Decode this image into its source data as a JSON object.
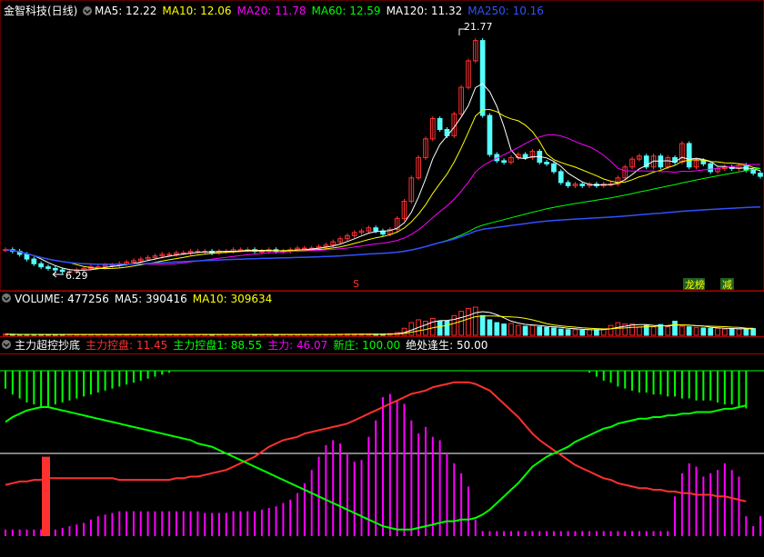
{
  "header": {
    "title": "金智科技(日线)",
    "ma": [
      {
        "label": "MA5: 12.22",
        "color": "#ffffff"
      },
      {
        "label": "MA10: 12.06",
        "color": "#ffff00"
      },
      {
        "label": "MA20: 11.78",
        "color": "#ff00ff"
      },
      {
        "label": "MA60: 12.59",
        "color": "#00ff00"
      },
      {
        "label": "MA120: 11.32",
        "color": "#ffffff"
      },
      {
        "label": "MA250: 10.16",
        "color": "#3050ff"
      }
    ]
  },
  "price_annotations": {
    "high": "21.77",
    "low": "6.29"
  },
  "markers": {
    "s": "S",
    "longhu": "龙榜",
    "reduce": "减"
  },
  "volume_header": [
    {
      "label": "VOLUME: 477256",
      "color": "#ffffff"
    },
    {
      "label": "MA5: 390416",
      "color": "#ffffff"
    },
    {
      "label": "MA10: 309634",
      "color": "#ffff00"
    }
  ],
  "indicator_header": [
    {
      "label": "主力超控抄底",
      "color": "#ffffff"
    },
    {
      "label": "主力控盘: 11.45",
      "color": "#ff3030"
    },
    {
      "label": "主力控盘1: 88.55",
      "color": "#00ff00"
    },
    {
      "label": "主力: 46.07",
      "color": "#ff00ff"
    },
    {
      "label": "新庄: 100.00",
      "color": "#00ff00"
    },
    {
      "label": "绝处逢生: 50.00",
      "color": "#ffffff"
    }
  ],
  "colors": {
    "up": "#ff3030",
    "down": "#54ffff",
    "ma5": "#ffffff",
    "ma10": "#ffff00",
    "ma20": "#ff00ff",
    "ma60": "#00ff00",
    "ma250": "#3050ff",
    "grid": "#b00000"
  },
  "chart_data": {
    "type": "candlestick",
    "price_min": 5.5,
    "price_max": 22.5,
    "close": [
      7.9,
      7.8,
      7.6,
      7.3,
      7.0,
      6.8,
      6.7,
      6.6,
      6.5,
      6.5,
      6.6,
      6.7,
      6.8,
      6.8,
      6.9,
      6.9,
      7.0,
      7.1,
      7.2,
      7.3,
      7.4,
      7.5,
      7.6,
      7.6,
      7.7,
      7.7,
      7.8,
      7.8,
      7.8,
      7.7,
      7.8,
      7.8,
      7.9,
      7.9,
      7.9,
      7.8,
      7.8,
      7.9,
      7.8,
      7.8,
      7.9,
      8.0,
      8.0,
      8.0,
      8.1,
      8.2,
      8.4,
      8.6,
      8.8,
      9.0,
      9.1,
      9.3,
      9.1,
      8.9,
      9.2,
      9.9,
      11.0,
      12.5,
      13.8,
      15.0,
      16.3,
      15.6,
      15.2,
      16.6,
      18.3,
      20.0,
      21.3,
      16.5,
      14.0,
      13.6,
      13.5,
      13.8,
      14.0,
      13.8,
      14.2,
      13.5,
      13.4,
      12.9,
      12.2,
      12.0,
      12.1,
      12.0,
      12.1,
      12.0,
      12.1,
      12.1,
      12.5,
      13.2,
      13.7,
      13.9,
      13.2,
      13.9,
      13.2,
      13.8,
      13.5,
      14.7,
      13.2,
      13.6,
      13.4,
      12.9,
      13.1,
      13.2,
      13.1,
      13.3,
      13.0,
      12.8,
      12.6
    ],
    "volume": [
      0.04,
      0.03,
      0.03,
      0.03,
      0.03,
      0.03,
      0.03,
      0.03,
      0.03,
      0.03,
      0.03,
      0.03,
      0.03,
      0.03,
      0.03,
      0.03,
      0.03,
      0.03,
      0.03,
      0.03,
      0.03,
      0.03,
      0.03,
      0.03,
      0.03,
      0.03,
      0.03,
      0.03,
      0.03,
      0.03,
      0.03,
      0.03,
      0.03,
      0.03,
      0.03,
      0.03,
      0.03,
      0.03,
      0.03,
      0.03,
      0.03,
      0.03,
      0.03,
      0.03,
      0.03,
      0.03,
      0.03,
      0.04,
      0.04,
      0.04,
      0.04,
      0.04,
      0.04,
      0.04,
      0.06,
      0.1,
      0.25,
      0.45,
      0.55,
      0.5,
      0.6,
      0.5,
      0.5,
      0.7,
      0.85,
      0.95,
      1.0,
      0.7,
      0.55,
      0.45,
      0.4,
      0.42,
      0.35,
      0.32,
      0.35,
      0.3,
      0.28,
      0.26,
      0.22,
      0.2,
      0.2,
      0.18,
      0.2,
      0.2,
      0.22,
      0.35,
      0.45,
      0.4,
      0.4,
      0.3,
      0.35,
      0.3,
      0.38,
      0.3,
      0.5,
      0.32,
      0.3,
      0.28,
      0.26,
      0.24,
      0.25,
      0.22,
      0.24,
      0.22,
      0.23,
      0.24
    ],
    "main_control": [
      31,
      32,
      33,
      33,
      34,
      34,
      35,
      35,
      35,
      35,
      35,
      35,
      35,
      35,
      35,
      35,
      34,
      34,
      34,
      34,
      34,
      34,
      34,
      34,
      35,
      35,
      36,
      36,
      37,
      38,
      39,
      40,
      42,
      44,
      46,
      48,
      51,
      54,
      56,
      58,
      59,
      60,
      62,
      63,
      64,
      65,
      66,
      67,
      68,
      70,
      72,
      74,
      76,
      78,
      80,
      82,
      84,
      86,
      87,
      88,
      90,
      91,
      92,
      93,
      93,
      93,
      92,
      90,
      88,
      84,
      80,
      76,
      72,
      67,
      62,
      58,
      55,
      52,
      49,
      46,
      43,
      41,
      39,
      37,
      35,
      34,
      32,
      31,
      30,
      29,
      29,
      28,
      28,
      27,
      27,
      26,
      26,
      25,
      25,
      25,
      24,
      24,
      23,
      22,
      21
    ],
    "main_control_1": [
      69,
      72,
      74,
      76,
      77,
      78,
      78,
      77,
      76,
      75,
      74,
      73,
      72,
      71,
      70,
      69,
      68,
      67,
      66,
      65,
      64,
      63,
      62,
      61,
      60,
      59,
      58,
      56,
      55,
      54,
      52,
      50,
      48,
      46,
      44,
      42,
      40,
      38,
      36,
      34,
      32,
      30,
      28,
      26,
      24,
      22,
      20,
      18,
      16,
      14,
      12,
      10,
      8,
      6,
      5,
      4,
      4,
      4,
      5,
      6,
      7,
      8,
      9,
      9,
      10,
      10,
      11,
      13,
      16,
      20,
      24,
      28,
      32,
      37,
      42,
      45,
      48,
      50,
      52,
      54,
      57,
      59,
      61,
      63,
      65,
      66,
      68,
      69,
      70,
      71,
      71,
      72,
      72,
      73,
      73,
      74,
      74,
      75,
      75,
      75,
      76,
      77,
      77,
      78,
      79
    ],
    "main_force": [
      4,
      4,
      4,
      4,
      4,
      4,
      4,
      4,
      5,
      6,
      7,
      8,
      10,
      12,
      13,
      14,
      15,
      15,
      15,
      15,
      15,
      15,
      15,
      15,
      15,
      15,
      15,
      15,
      14,
      14,
      14,
      14,
      15,
      15,
      15,
      15,
      16,
      17,
      18,
      20,
      22,
      26,
      32,
      40,
      48,
      55,
      58,
      56,
      50,
      45,
      46,
      60,
      70,
      84,
      86,
      82,
      80,
      70,
      62,
      66,
      60,
      58,
      50,
      44,
      38,
      30,
      10,
      3,
      3,
      3,
      3,
      3,
      3,
      3,
      3,
      3,
      3,
      3,
      3,
      3,
      3,
      3,
      3,
      3,
      3,
      3,
      3,
      3,
      3,
      3,
      3,
      3,
      3,
      3,
      24,
      38,
      44,
      42,
      36,
      38,
      40,
      44,
      40,
      36,
      12,
      6,
      12,
      16,
      12,
      4
    ],
    "axis_ref": 50
  }
}
